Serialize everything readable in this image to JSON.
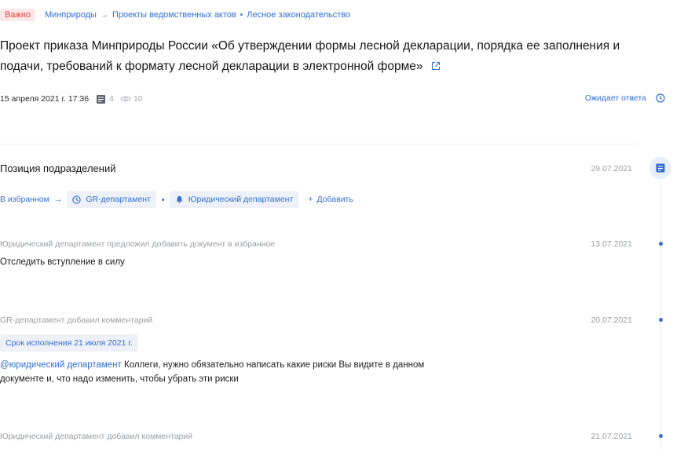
{
  "breadcrumbs": {
    "badge": "Важно",
    "items": [
      "Минприроды",
      "Проекты ведомственных актов",
      "Лесное законодательство"
    ],
    "sep_arrow": "→",
    "sep_bullet": "•"
  },
  "document": {
    "title_line1": "Проект приказа Минприроды России «Об утверждении формы лесной декларации, порядка ее заполнения и",
    "title_line2": "подачи, требований к формату лесной декларации в электронной форме»",
    "datetime": "15 апреля 2021 г. 17:36",
    "comments_count": "4",
    "views_count": "10",
    "status": "Ожидает ответа"
  },
  "positions": {
    "title": "Позиция подразделений",
    "date": "29.07.2021",
    "favorites_label": "В избранном",
    "arrow": "→",
    "departments": [
      "GR-департамент",
      "Юридический департамент"
    ],
    "add_label": "Добавить",
    "plus": "+"
  },
  "events": [
    {
      "caption": "Юридический департамент предложил добавить документ в избранное",
      "date": "13.07.2021",
      "text": "Отследить вступление в силу"
    },
    {
      "caption": "GR-департамент добавил комментарий",
      "date": "20.07.2021",
      "deadline": "Срок исполнения 21 июля 2021 г.",
      "mention": "@юридический департамент",
      "text_line1": " Коллеги, нужно обязательно написать какие риски Вы видите в данном",
      "text_line2": "документе и, что надо изменить, чтобы убрать эти риски"
    },
    {
      "caption": "Юридический департамент добавил комментарий",
      "date": "21.07.2021"
    }
  ],
  "icons": {
    "external": "external-link-icon",
    "document": "document-icon",
    "views": "eye-icon",
    "clock": "clock-icon",
    "comment": "comment-icon",
    "bell": "bell-icon"
  },
  "colors": {
    "accent": "#2f6fd6",
    "important_bg": "#fde8e8",
    "important_text": "#e2463d",
    "muted": "#9aa0a8"
  }
}
